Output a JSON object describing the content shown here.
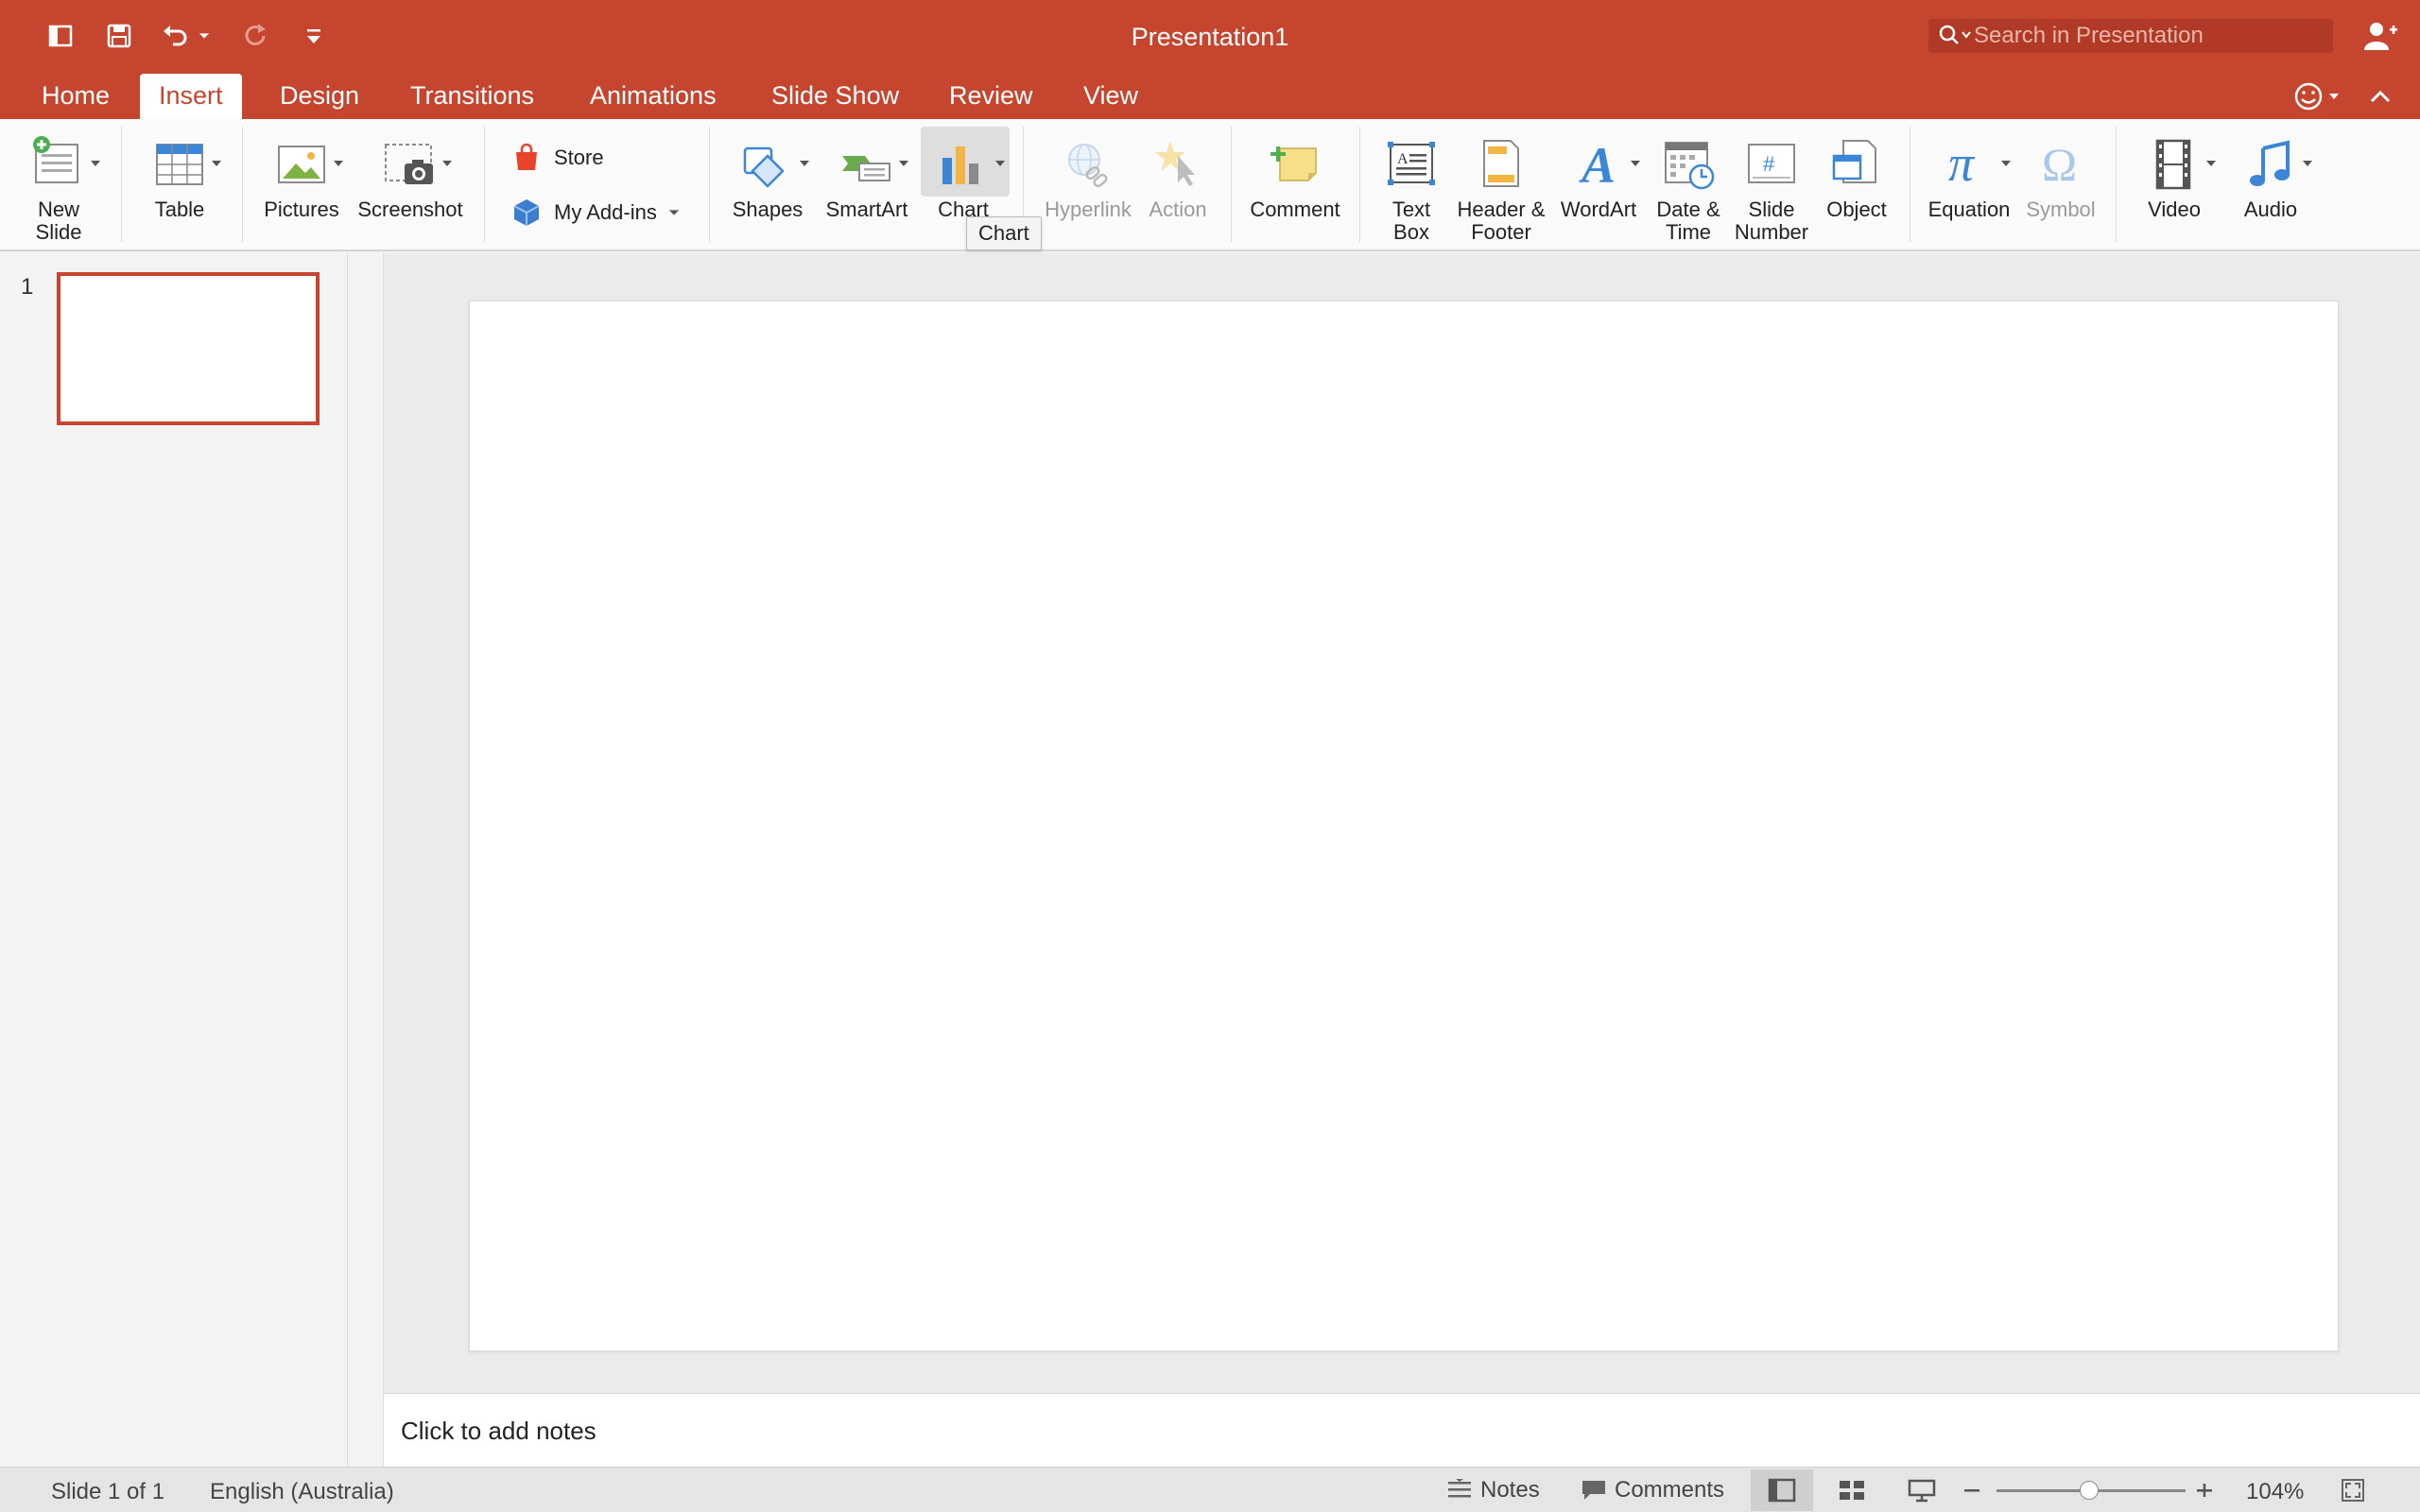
{
  "app": {
    "title": "Presentation1",
    "search_placeholder": "Search in Presentation"
  },
  "tabs": [
    {
      "label": "Home"
    },
    {
      "label": "Insert"
    },
    {
      "label": "Design"
    },
    {
      "label": "Transitions"
    },
    {
      "label": "Animations"
    },
    {
      "label": "Slide Show"
    },
    {
      "label": "Review"
    },
    {
      "label": "View"
    }
  ],
  "active_tab": "Insert",
  "ribbon": {
    "new_slide": "New\nSlide",
    "table": "Table",
    "pictures": "Pictures",
    "screenshot": "Screenshot",
    "store": "Store",
    "my_addins": "My Add-ins",
    "shapes": "Shapes",
    "smartart": "SmartArt",
    "chart": "Chart",
    "hyperlink": "Hyperlink",
    "action": "Action",
    "comment": "Comment",
    "text_box": "Text\nBox",
    "header_footer": "Header &\nFooter",
    "wordart": "WordArt",
    "date_time": "Date &\nTime",
    "slide_number": "Slide\nNumber",
    "object": "Object",
    "equation": "Equation",
    "symbol": "Symbol",
    "video": "Video",
    "audio": "Audio"
  },
  "tooltip": "Chart",
  "thumbnails": [
    {
      "number": "1"
    }
  ],
  "notes_placeholder": "Click to add notes",
  "status": {
    "slide_info": "Slide 1 of 1",
    "language": "English (Australia)",
    "notes": "Notes",
    "comments": "Comments",
    "zoom": "104%"
  },
  "colors": {
    "accent": "#c5452e",
    "ribbon_bg": "#fafafa",
    "icon_blue": "#2b7bd8"
  }
}
